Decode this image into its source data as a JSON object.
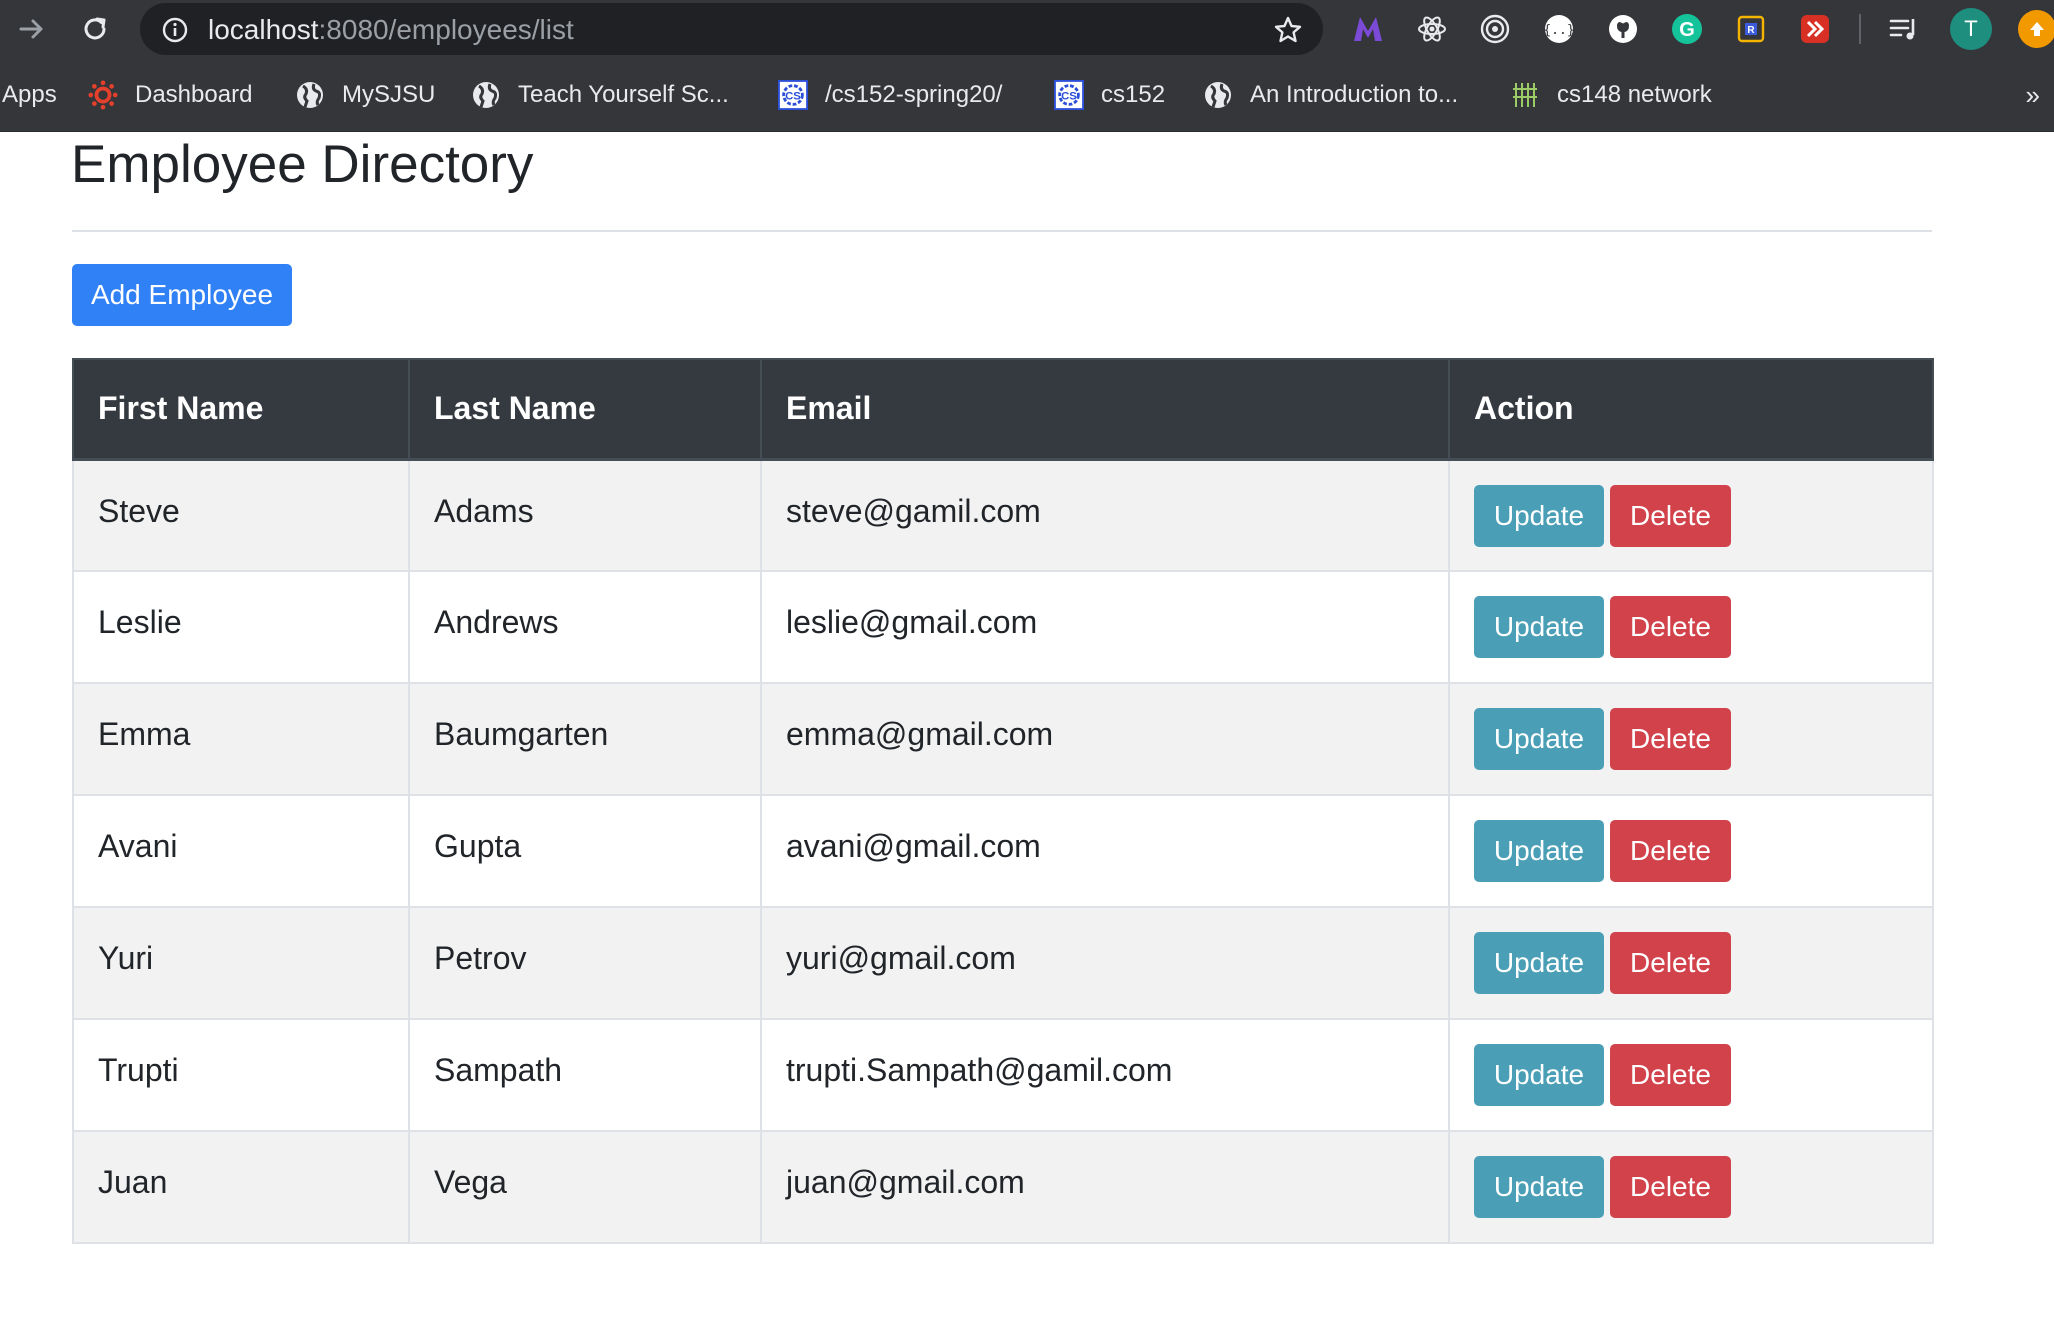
{
  "browser": {
    "url_host": "localhost",
    "url_path": ":8080/employees/list",
    "extensions": [
      "monica-icon",
      "react-devtools-icon",
      "target-icon",
      "json-icon",
      "github-icon",
      "grammarly-icon",
      "rss-icon",
      "redirect-icon"
    ],
    "profile_initial": "T",
    "colors": {
      "toolbar": "#35363a",
      "omnibox": "#202124",
      "profile": "#1e8e7e",
      "update": "#f29900"
    }
  },
  "bookmarks": {
    "items": [
      {
        "label": "Apps",
        "icon": "apps-icon"
      },
      {
        "label": "Dashboard",
        "icon": "canvas-icon"
      },
      {
        "label": "MySJSU",
        "icon": "globe-icon"
      },
      {
        "label": "Teach Yourself Sc...",
        "icon": "globe-icon"
      },
      {
        "label": "/cs152-spring20/",
        "icon": "cs-logo-icon"
      },
      {
        "label": "cs152",
        "icon": "cs-logo-icon"
      },
      {
        "label": "An Introduction to...",
        "icon": "globe-icon"
      },
      {
        "label": "cs148 network",
        "icon": "network-icon"
      }
    ],
    "overflow": "»"
  },
  "page": {
    "title": "Employee Directory",
    "add_button": "Add Employee"
  },
  "table": {
    "columns": [
      "First Name",
      "Last Name",
      "Email",
      "Action"
    ],
    "rows": [
      {
        "first": "Steve",
        "last": "Adams",
        "email": "steve@gamil.com"
      },
      {
        "first": "Leslie",
        "last": "Andrews",
        "email": "leslie@gmail.com"
      },
      {
        "first": "Emma",
        "last": "Baumgarten",
        "email": "emma@gmail.com"
      },
      {
        "first": "Avani",
        "last": "Gupta",
        "email": "avani@gmail.com"
      },
      {
        "first": "Yuri",
        "last": "Petrov",
        "email": "yuri@gmail.com"
      },
      {
        "first": "Trupti",
        "last": "Sampath",
        "email": "trupti.Sampath@gamil.com"
      },
      {
        "first": "Juan",
        "last": "Vega",
        "email": "juan@gmail.com"
      }
    ],
    "update_label": "Update",
    "delete_label": "Delete"
  },
  "colors": {
    "primary": "#3080f6",
    "header_bg": "#343a40",
    "update_btn": "#4a9fb7",
    "delete_btn": "#d1424b",
    "stripe": "#f2f2f2"
  }
}
